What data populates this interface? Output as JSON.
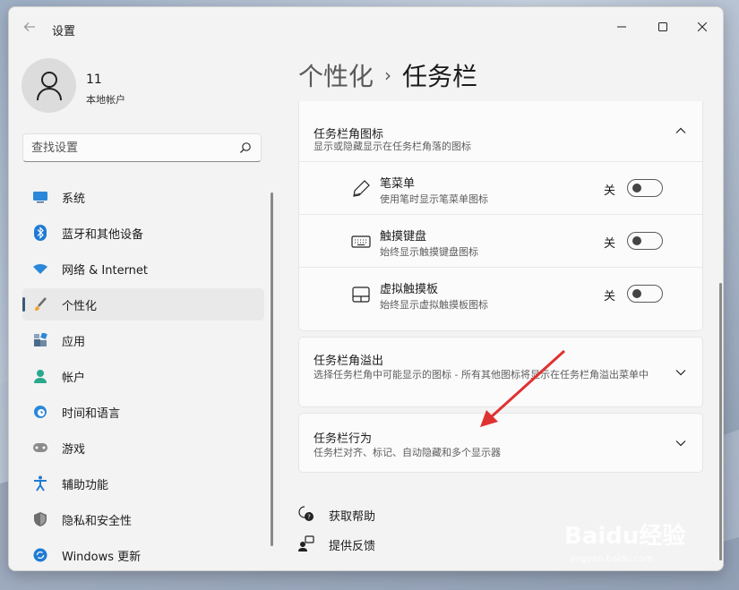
{
  "window": {
    "title": "设置"
  },
  "account": {
    "name": "11",
    "type": "本地帐户"
  },
  "search": {
    "placeholder": "查找设置"
  },
  "sidebar": {
    "items": [
      {
        "label": "系统",
        "icon": "monitor-icon"
      },
      {
        "label": "蓝牙和其他设备",
        "icon": "bluetooth-icon"
      },
      {
        "label": "网络 & Internet",
        "icon": "wifi-icon"
      },
      {
        "label": "个性化",
        "icon": "brush-icon",
        "active": true
      },
      {
        "label": "应用",
        "icon": "apps-icon"
      },
      {
        "label": "帐户",
        "icon": "person-icon"
      },
      {
        "label": "时间和语言",
        "icon": "globe-clock-icon"
      },
      {
        "label": "游戏",
        "icon": "gamepad-icon"
      },
      {
        "label": "辅助功能",
        "icon": "accessibility-icon"
      },
      {
        "label": "隐私和安全性",
        "icon": "shield-icon"
      },
      {
        "label": "Windows 更新",
        "icon": "update-icon"
      }
    ]
  },
  "breadcrumb": {
    "parent": "个性化",
    "separator": "›",
    "current": "任务栏"
  },
  "sections": {
    "corner_icons": {
      "title": "任务栏角图标",
      "desc": "显示或隐藏显示在任务栏角落的图标",
      "items": [
        {
          "title": "笔菜单",
          "desc": "使用笔时显示笔菜单图标",
          "state": "关",
          "icon": "pen-icon"
        },
        {
          "title": "触摸键盘",
          "desc": "始终显示触摸键盘图标",
          "state": "关",
          "icon": "keyboard-icon"
        },
        {
          "title": "虚拟触摸板",
          "desc": "始终显示虚拟触摸板图标",
          "state": "关",
          "icon": "touchpad-icon"
        }
      ]
    },
    "overflow": {
      "title": "任务栏角溢出",
      "desc": "选择任务栏角中可能显示的图标 - 所有其他图标将显示在任务栏角溢出菜单中"
    },
    "behaviors": {
      "title": "任务栏行为",
      "desc": "任务栏对齐、标记、自动隐藏和多个显示器"
    }
  },
  "links": {
    "help": "获取帮助",
    "feedback": "提供反馈"
  },
  "watermark": {
    "brand": "Baidu经验",
    "url": "jingyan.baidu.com"
  },
  "colors": {
    "accent": "#3c5a77",
    "annotation_arrow": "#e03131"
  }
}
